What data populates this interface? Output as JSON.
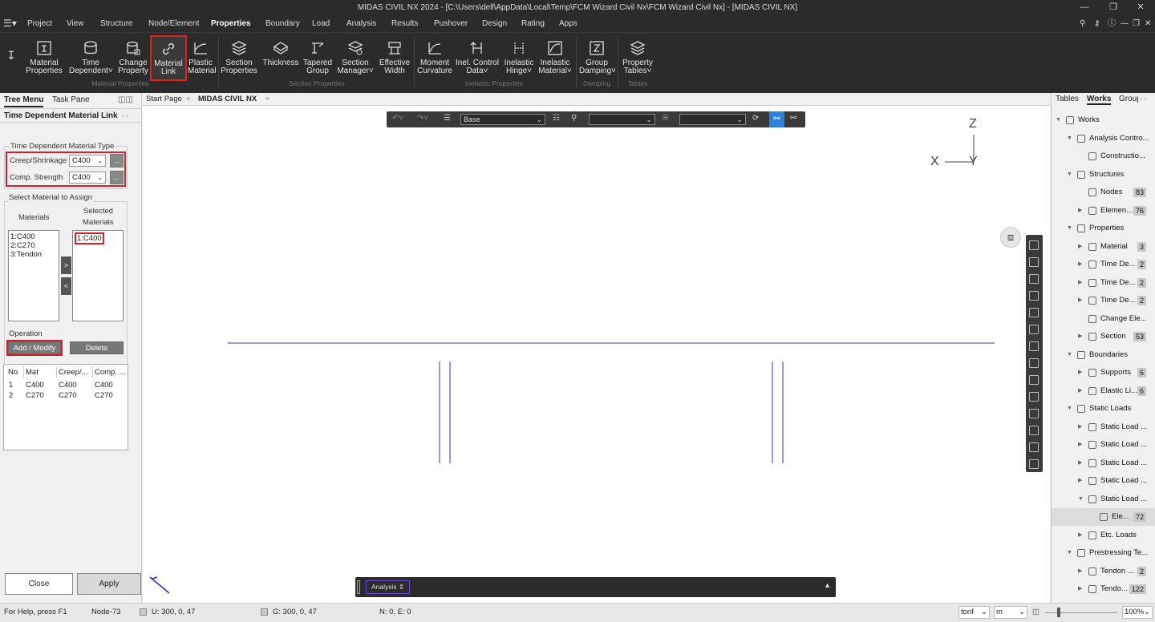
{
  "window": {
    "title": "MIDAS CIVIL NX 2024 - [C:\\Users\\dell\\AppData\\Local\\Temp\\FCM Wizard Civil Nx\\FCM Wizard Civil Nx] - [MIDAS CIVIL NX]"
  },
  "menu": [
    "Project",
    "View",
    "Structure",
    "Node/Element",
    "Properties",
    "Boundary",
    "Load",
    "Analysis",
    "Results",
    "Pushover",
    "Design",
    "Rating",
    "Apps"
  ],
  "menu_active": "Properties",
  "ribbon": {
    "buttons": [
      {
        "label1": "Material",
        "label2": "Properties"
      },
      {
        "label1": "Time",
        "label2": "Dependent"
      },
      {
        "label1": "Change",
        "label2": "Property"
      },
      {
        "label1": "Material",
        "label2": "Link"
      },
      {
        "label1": "Plastic",
        "label2": "Material"
      },
      {
        "label1": "Section",
        "label2": "Properties"
      },
      {
        "label1": "Thickness",
        "label2": ""
      },
      {
        "label1": "Tapered",
        "label2": "Group"
      },
      {
        "label1": "Section",
        "label2": "Manager"
      },
      {
        "label1": "Effective",
        "label2": "Width"
      },
      {
        "label1": "Moment",
        "label2": "Curvature"
      },
      {
        "label1": "Inel. Control",
        "label2": "Data"
      },
      {
        "label1": "Inelastic",
        "label2": "Hinge"
      },
      {
        "label1": "Inelastic",
        "label2": "Material"
      },
      {
        "label1": "Group",
        "label2": "Damping"
      },
      {
        "label1": "Property",
        "label2": "Tables"
      }
    ],
    "groups": [
      "Material Properties",
      "Section Properties",
      "Inelastic Properties",
      "Damping",
      "Tables"
    ]
  },
  "left_panel": {
    "tabs": [
      "Tree Menu",
      "Task Pane"
    ],
    "title": "Time Dependent Material Link",
    "type_group": "Time Dependent Material Type",
    "creep_label": "Creep/Shrinkage",
    "creep_value": "C400",
    "comp_label": "Comp. Strength",
    "comp_value": "C400",
    "dots": "...",
    "assign_group": "Select Material to Assign",
    "materials_header": "Materials",
    "selected_header1": "Selected",
    "selected_header2": "Materials",
    "materials": [
      "1:C400",
      "2:C270",
      "3:Tendon"
    ],
    "selected": [
      "1:C400"
    ],
    "add_arrow": ">",
    "remove_arrow": "<",
    "operation_group": "Operation",
    "add_modify": "Add / Modify",
    "delete": "Delete",
    "table": {
      "headers": [
        "No",
        "Mat",
        "Creep/...",
        "Comp. ..."
      ],
      "rows": [
        [
          "1",
          "C400",
          "C400",
          "C400"
        ],
        [
          "2",
          "C270",
          "C270",
          "C270"
        ]
      ]
    },
    "close": "Close",
    "apply": "Apply"
  },
  "doc_tabs": [
    "Start Page",
    "MIDAS CIVIL NX"
  ],
  "viewer": {
    "toolbar_select": "Base",
    "axis_z": "Z",
    "axis_x": "X",
    "axis_y": "Y",
    "cmd_tab": "Analysis"
  },
  "right_panel": {
    "tabs": [
      "Tables",
      "Works",
      "Group"
    ],
    "tree": [
      {
        "label": "Works",
        "level": 0,
        "exp": "down"
      },
      {
        "label": "Analysis Contro...",
        "level": 1,
        "exp": "down"
      },
      {
        "label": "Constructio...",
        "level": 2,
        "exp": ""
      },
      {
        "label": "Structures",
        "level": 1,
        "exp": "down"
      },
      {
        "label": "Nodes",
        "level": 2,
        "exp": "",
        "badge": "83"
      },
      {
        "label": "Elemen...",
        "level": 2,
        "exp": "right",
        "badge": "76"
      },
      {
        "label": "Properties",
        "level": 1,
        "exp": "down"
      },
      {
        "label": "Material",
        "level": 2,
        "exp": "right",
        "badge": "3"
      },
      {
        "label": "Time De...",
        "level": 2,
        "exp": "right",
        "badge": "2"
      },
      {
        "label": "Time De...",
        "level": 2,
        "exp": "right",
        "badge": "2"
      },
      {
        "label": "Time De...",
        "level": 2,
        "exp": "right",
        "badge": "2"
      },
      {
        "label": "Change Ele...",
        "level": 2,
        "exp": ""
      },
      {
        "label": "Section",
        "level": 2,
        "exp": "right",
        "badge": "53"
      },
      {
        "label": "Boundaries",
        "level": 1,
        "exp": "down"
      },
      {
        "label": "Supports",
        "level": 2,
        "exp": "right",
        "badge": "6"
      },
      {
        "label": "Elastic Li...",
        "level": 2,
        "exp": "right",
        "badge": "6"
      },
      {
        "label": "Static Loads",
        "level": 1,
        "exp": "down"
      },
      {
        "label": "Static Load ...",
        "level": 2,
        "exp": "right"
      },
      {
        "label": "Static Load ...",
        "level": 2,
        "exp": "right"
      },
      {
        "label": "Static Load ...",
        "level": 2,
        "exp": "right"
      },
      {
        "label": "Static Load ...",
        "level": 2,
        "exp": "right"
      },
      {
        "label": "Static Load ...",
        "level": 2,
        "exp": "down"
      },
      {
        "label": "Ele...",
        "level": 3,
        "exp": "",
        "badge": "72"
      },
      {
        "label": "Etc. Loads",
        "level": 2,
        "exp": "right"
      },
      {
        "label": "Prestressing Te...",
        "level": 1,
        "exp": "down"
      },
      {
        "label": "Tendon ...",
        "level": 2,
        "exp": "right",
        "badge": "2"
      },
      {
        "label": "Tendo...",
        "level": 2,
        "exp": "right",
        "badge": "122"
      }
    ]
  },
  "status": {
    "help": "For Help, press F1",
    "node": "Node-73",
    "u": "U: 300, 0, 47",
    "g": "G: 300, 0, 47",
    "ne": "N: 0, E: 0",
    "force_unit": "tonf",
    "length_unit": "m",
    "zoom": "100%"
  }
}
